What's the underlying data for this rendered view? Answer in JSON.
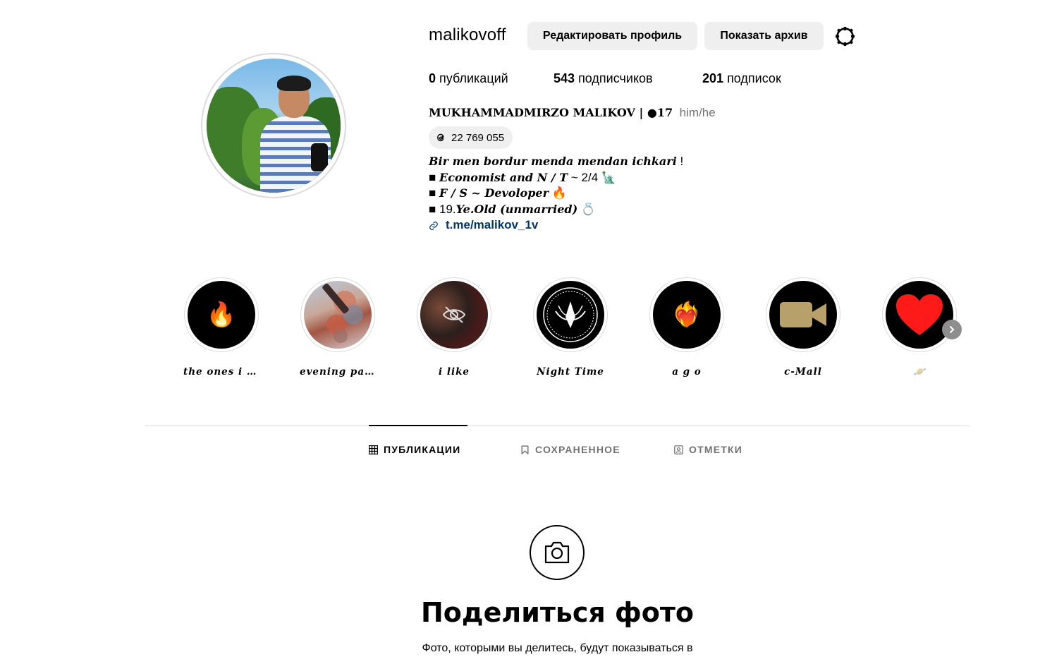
{
  "profile": {
    "username": "malikovoff",
    "edit_profile_label": "Редактировать профиль",
    "show_archive_label": "Показать архив",
    "stats": {
      "posts_count": "0",
      "posts_label": "публикаций",
      "followers_count": "543",
      "followers_label": "подписчиков",
      "following_count": "201",
      "following_label": "подписок"
    },
    "full_name": "MUKHAMMADMIRZO MALIKOV | ●17",
    "pronouns": "him/he",
    "threads_count": "22 769 055",
    "bio": {
      "line1_italic": "Bir men bordur menda mendan ichkari",
      "line1_tail": " !",
      "line2_bullet": "■ ",
      "line2_italic": "Economist and N / T",
      "line2_tail": " ~ 2/4 🗽",
      "line3_bullet": "■ ",
      "line3_italic": "F / S ~ Devoloper",
      "line3_tail": " 🔥",
      "line4_bullet": "■ 19.",
      "line4_italic": "Ye.Old (unmarried)",
      "line4_tail": " 💍",
      "link": "t.me/malikov_1v"
    }
  },
  "highlights": [
    {
      "label": "the ones i l...",
      "emoji": "🔥"
    },
    {
      "label": "evening pa...",
      "emoji": ""
    },
    {
      "label": "i like",
      "emoji": ""
    },
    {
      "label": "Night Time",
      "emoji": ""
    },
    {
      "label": "a g o",
      "emoji": "❤️‍🔥"
    },
    {
      "label": "c-Mall",
      "emoji": ""
    },
    {
      "label": "🪐",
      "emoji": "❤️"
    }
  ],
  "tabs": {
    "posts": "ПУБЛИКАЦИИ",
    "saved": "СОХРАНЕННОЕ",
    "tagged": "ОТМЕТКИ"
  },
  "empty_state": {
    "title": "Поделиться фото",
    "text": "Фото, которыми вы делитесь, будут показываться в"
  }
}
